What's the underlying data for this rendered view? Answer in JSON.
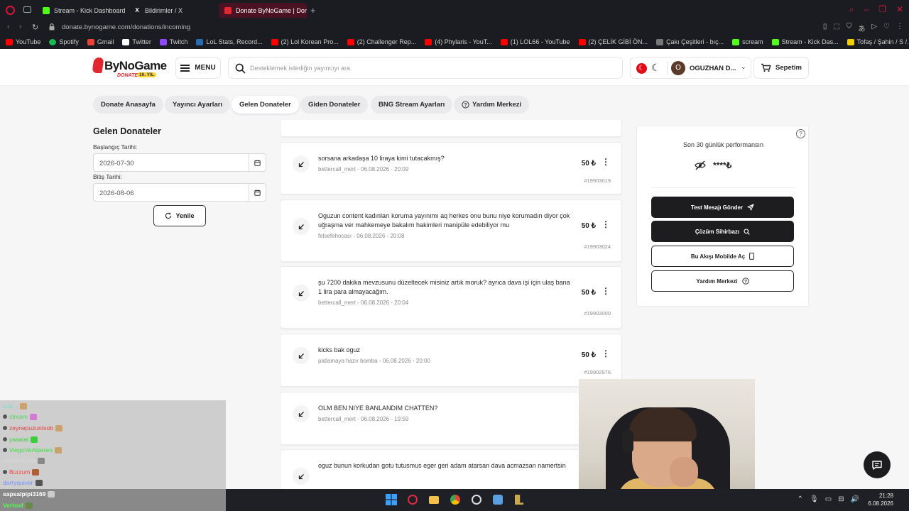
{
  "browser": {
    "tabs": [
      {
        "label": "Stream - Kick Dashboard",
        "favicon": "kick-icon"
      },
      {
        "label": "Bildirimler / X",
        "favicon": "x-icon"
      },
      {
        "label": "Donate ByNoGame | Donat",
        "favicon": "bynogame-icon",
        "active": true
      }
    ],
    "url": "donate.bynogame.com/donations/incoming",
    "bookmarks": [
      {
        "label": "YouTube",
        "color": "#ff0000"
      },
      {
        "label": "Spotify",
        "color": "#1db954"
      },
      {
        "label": "Gmail",
        "color": "#ea4335"
      },
      {
        "label": "Twitter",
        "color": "#ffffff"
      },
      {
        "label": "Twitch",
        "color": "#9146ff"
      },
      {
        "label": "LoL Stats, Record...",
        "color": "#2b6cb0"
      },
      {
        "label": "(2) Lol Korean Pro...",
        "color": "#ff0000"
      },
      {
        "label": "(2) Challenger Rep...",
        "color": "#ff0000"
      },
      {
        "label": "(4) Phylaris - YouT...",
        "color": "#ff0000"
      },
      {
        "label": "(1) LOL66 - YouTube",
        "color": "#ff0000"
      },
      {
        "label": "(2) ÇELİK GİBİ ÖN...",
        "color": "#ff0000"
      },
      {
        "label": "Çakı Çeşitleri - bıç...",
        "color": "#777777"
      },
      {
        "label": "scream",
        "color": "#53fc18"
      },
      {
        "label": "Stream - Kick Das...",
        "color": "#53fc18"
      },
      {
        "label": "Tofaş / Şahin / S /...",
        "color": "#f5d000"
      }
    ]
  },
  "header": {
    "logo_text": "ByNoGame",
    "logo_sub": "DONATE",
    "logo_badge": "10. YIL",
    "menu_label": "MENU",
    "search_placeholder": "Desteklemek istediğin yayıncıyı ara",
    "avatar_letter": "O",
    "username": "OGUZHAN D...",
    "cart_label": "Sepetim"
  },
  "subnav": [
    {
      "label": "Donate Anasayfa"
    },
    {
      "label": "Yayıncı Ayarları"
    },
    {
      "label": "Gelen Donateler",
      "active": true
    },
    {
      "label": "Giden Donateler"
    },
    {
      "label": "BNG Stream Ayarları"
    },
    {
      "label": "Yardım Merkezi"
    }
  ],
  "filters": {
    "title": "Gelen Donateler",
    "start_label": "Başlangıç Tarihi:",
    "start_value": "2026-07-30",
    "end_label": "Bitiş Tarihi:",
    "end_value": "2026-08-06",
    "refresh_label": "Yenile"
  },
  "donations": [
    {
      "message": "sorsana arkadaşa 10 liraya kimi tutacakmış?",
      "sender": "bettercall_mert",
      "datetime": "06.08.2026 - 20:09",
      "amount": "50 ₺",
      "id": "#19903019"
    },
    {
      "message": "Oguzun content kadınları koruma yayınımı aq herkes onu bunu niye korumadın diyor çok uğraşma ver mahkemeye bakalım hakimleri manipüle edebiliyor mu",
      "sender": "felsefehocası",
      "datetime": "06.08.2026 - 20:08",
      "amount": "50 ₺",
      "id": "#19903024"
    },
    {
      "message": "şu 7200 dakika mevzusunu düzeltecek misiniz artık moruk? ayrıca dava işi için ulaş bana 1 lira para almayacağım.",
      "sender": "bettercall_mert",
      "datetime": "06.08.2026 - 20:04",
      "amount": "50 ₺",
      "id": "#19903000"
    },
    {
      "message": "kicks bak oguz",
      "sender": "patlamaya hazır bomba",
      "datetime": "06.08.2026 - 20:00",
      "amount": "50 ₺",
      "id": "#19902976"
    },
    {
      "message": "OLM BEN NIYE BANLANDIM CHATTEN?",
      "sender": "bettercall_mert",
      "datetime": "06.08.2026 - 19:59",
      "amount": "",
      "id": ""
    },
    {
      "message": "oguz bunun korkudan gotu tutusmus eger geri adam atarsan dava acmazsan namertsin",
      "sender": "",
      "datetime": "",
      "amount": "",
      "id": ""
    }
  ],
  "performance": {
    "title": "Son 30 günlük performansın",
    "masked_value": "****₺",
    "buttons": [
      {
        "label": "Test Mesajı Gönder"
      },
      {
        "label": "Çözüm Sihirbazı"
      },
      {
        "label": "Bu Akışı Mobilde Aç"
      },
      {
        "label": "Yardım Merkezi"
      }
    ]
  },
  "stream_chat": [
    {
      "user": "Lux...",
      "color": "#6fe0c8"
    },
    {
      "user": "stream",
      "color": "#5ad45a"
    },
    {
      "user": "zeynepuzuntsob",
      "color": "#e04040"
    },
    {
      "user": "yaaaiai",
      "color": "#3ad03a"
    },
    {
      "user": "ViegoVeAlperen",
      "color": "#40e040"
    },
    {
      "user": "starrkcoyote",
      "color": "#c8c8c8"
    },
    {
      "user": "Burzum",
      "color": "#ff4040"
    },
    {
      "user": "darryquiver",
      "color": "#7090ff"
    },
    {
      "user": "sapsalpipi3169",
      "color": "#ffffff"
    },
    {
      "user": "Vertoxf",
      "color": "#50ff50"
    }
  ],
  "taskbar": {
    "time": "21:28",
    "date": "6.08.2026"
  }
}
